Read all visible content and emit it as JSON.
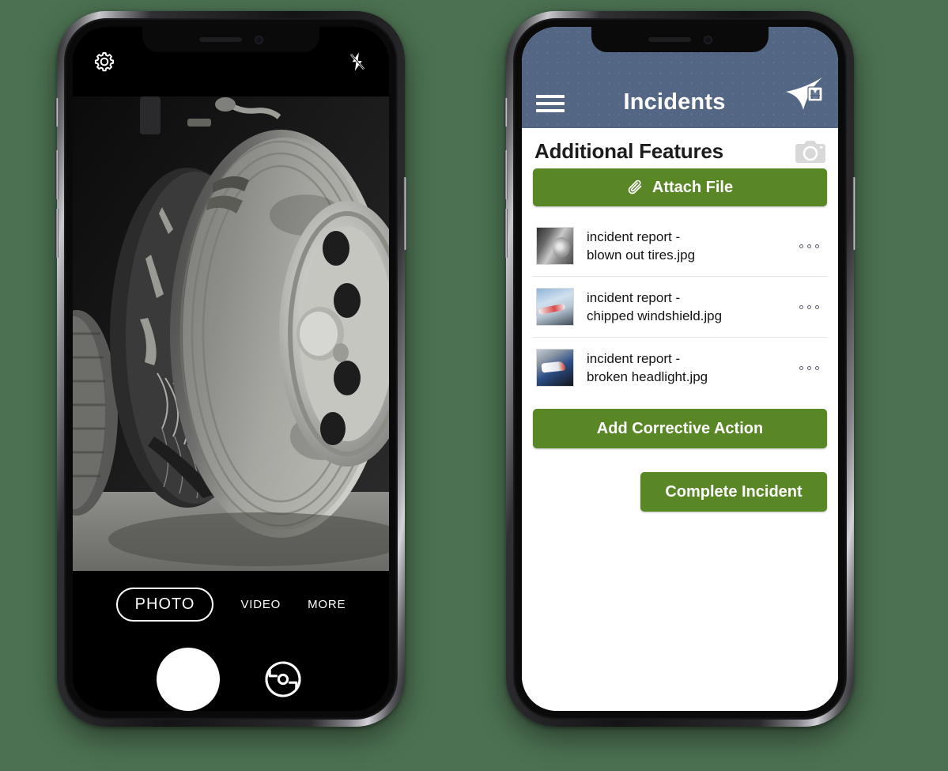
{
  "background_color": "#4c7152",
  "left_phone": {
    "name": "camera-app",
    "topbar": {
      "settings_icon": "gear-icon",
      "flash_icon": "flash-off-icon"
    },
    "viewfinder": {
      "subject": "close-up of a blown out truck tire with shredded steel belts",
      "alt": "damaged truck tire"
    },
    "modes": [
      {
        "label": "PHOTO",
        "active": true
      },
      {
        "label": "VIDEO",
        "active": false
      },
      {
        "label": "MORE",
        "active": false
      }
    ],
    "controls": {
      "shutter": "shutter-button",
      "flip": "flip-camera-icon"
    }
  },
  "right_phone": {
    "name": "incidents-app",
    "header": {
      "menu_icon": "hamburger-menu-icon",
      "title": "Incidents",
      "logo": "safety-vest-flag-logo",
      "background_color": "#536785"
    },
    "section": {
      "title": "Additional Features",
      "camera_icon": "camera-icon"
    },
    "attach_button": {
      "label": "Attach File",
      "icon": "paperclip-icon",
      "color": "#598725"
    },
    "files": [
      {
        "name": "incident report -\nblown out tires.jpg",
        "line1": "incident report -",
        "line2": "blown out tires.jpg",
        "thumb": "tire-thumbnail",
        "menu": "more-options-icon"
      },
      {
        "name": "incident report -\nchipped windshield.jpg",
        "line1": "incident report -",
        "line2": "chipped windshield.jpg",
        "thumb": "windshield-thumbnail",
        "menu": "more-options-icon"
      },
      {
        "name": "incident report -\nbroken headlight.jpg",
        "line1": "incident report -",
        "line2": "broken headlight.jpg",
        "thumb": "headlight-thumbnail",
        "menu": "more-options-icon"
      }
    ],
    "corrective_button": {
      "label": "Add Corrective Action",
      "color": "#598725"
    },
    "complete_button": {
      "label": "Complete Incident",
      "color": "#598725"
    }
  }
}
